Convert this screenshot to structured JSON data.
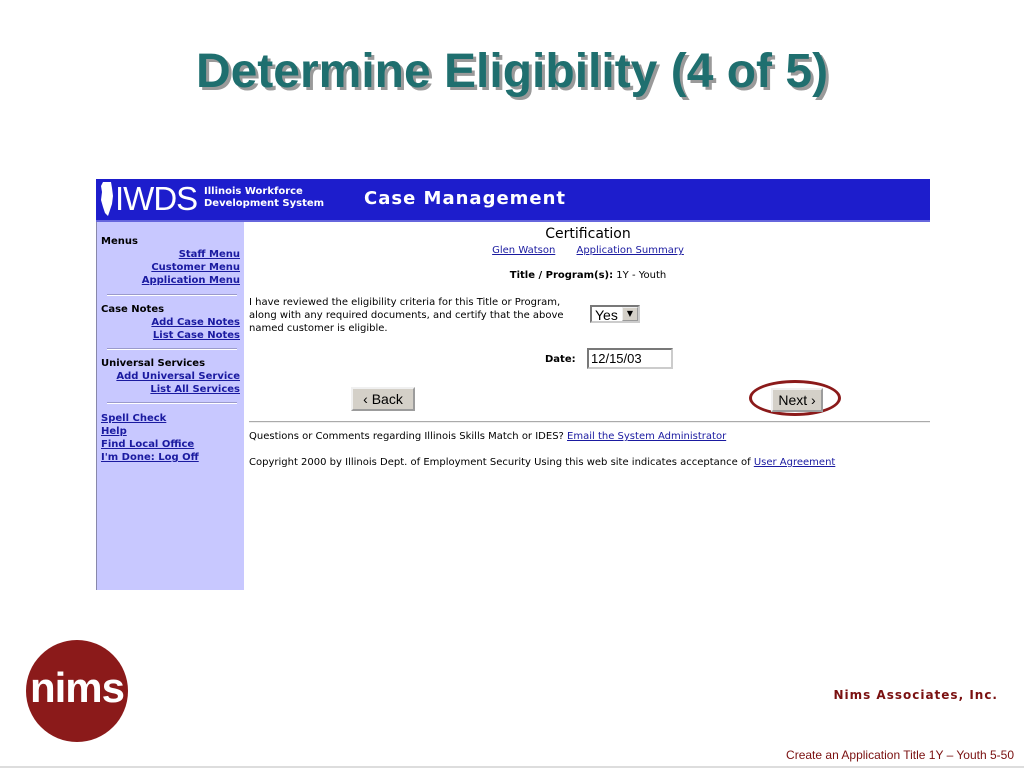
{
  "slide": {
    "title": "Determine Eligibility (4 of 5)",
    "company": "Nims Associates, Inc.",
    "logo_text": "nims",
    "footer_caption": "Create an Application Title 1Y – Youth  5-50"
  },
  "app": {
    "logo": "IWDS",
    "subtitle": "Illinois Workforce\nDevelopment System",
    "heading": "Case Management"
  },
  "sidebar": {
    "menus_head": "Menus",
    "staff_menu": "Staff Menu",
    "customer_menu": "Customer Menu",
    "application_menu": "Application Menu",
    "case_notes_head": "Case Notes",
    "add_case_notes": "Add Case Notes",
    "list_case_notes": "List Case Notes",
    "universal_head": "Universal Services",
    "add_universal": "Add Universal Service",
    "list_all_services": "List All Services",
    "spell_check": "Spell Check",
    "help": "Help",
    "find_local_office": "Find Local Office",
    "log_off": "I'm Done: Log Off"
  },
  "main": {
    "title": "Certification",
    "customer_link": "Glen Watson",
    "summary_link": "Application Summary",
    "program_label": "Title / Program(s):",
    "program_value": "1Y - Youth",
    "certify_text": "I have reviewed the eligibility criteria for this Title or Program, along with any required documents, and certify that the above named customer is eligible.",
    "certify_select_value": "Yes",
    "date_label": "Date:",
    "date_value": "12/15/03",
    "back_label": "‹ Back",
    "next_label": "Next ›",
    "questions_text": "Questions or Comments regarding Illinois Skills Match or IDES?",
    "email_link": "Email the System Administrator",
    "copyright_text": "Copyright 2000 by Illinois Dept. of Employment Security Using this web site indicates acceptance of",
    "agreement_link": "User Agreement"
  },
  "colors": {
    "title_teal": "#1f6f6f",
    "banner_blue": "#1d1dcc",
    "sidebar_lavender": "#c8c8ff",
    "highlight_ring": "#8b1a1a",
    "link_blue": "#1a1aa0"
  }
}
